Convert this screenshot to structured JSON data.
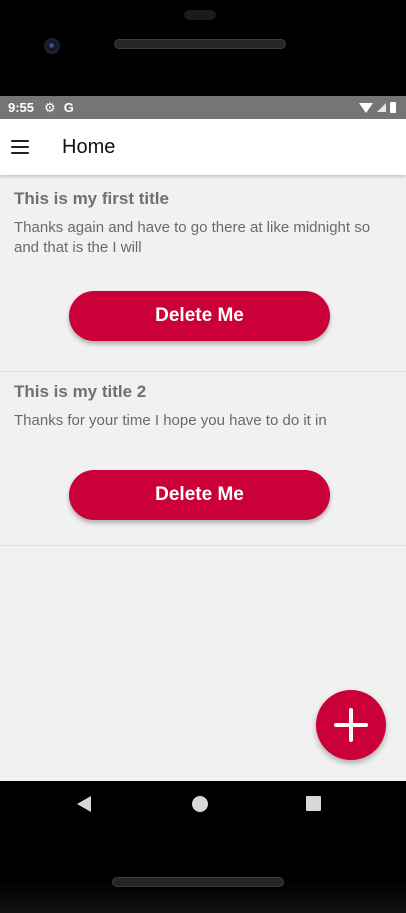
{
  "status_bar": {
    "time": "9:55",
    "gear_icon": "⚙",
    "g_icon": "G"
  },
  "app_bar": {
    "title": "Home"
  },
  "cards": [
    {
      "title": "This is my first title",
      "body": "Thanks again and have to go there at like midnight so and that is the I will",
      "button_label": "Delete Me"
    },
    {
      "title": "This is my title 2",
      "body": "Thanks for your time I hope you have to do it in",
      "button_label": "Delete Me"
    }
  ],
  "colors": {
    "accent": "#cc0038",
    "status_bar": "#757575",
    "background": "#f2f1f1"
  },
  "icons": {
    "menu": "hamburger-menu-icon",
    "fab": "plus-icon",
    "nav_back": "back-triangle-icon",
    "nav_home": "home-circle-icon",
    "nav_recents": "recents-square-icon"
  }
}
